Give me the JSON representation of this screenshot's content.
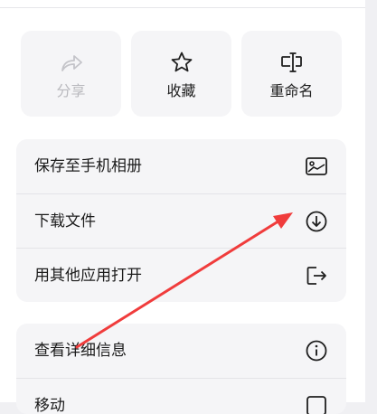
{
  "quick_actions": {
    "share_label": "分享",
    "favorite_label": "收藏",
    "rename_label": "重命名"
  },
  "menu_group_1": {
    "items": [
      {
        "label": "保存至手机相册",
        "icon": "image-icon"
      },
      {
        "label": "下载文件",
        "icon": "download-icon"
      },
      {
        "label": "用其他应用打开",
        "icon": "open-external-icon"
      }
    ]
  },
  "menu_group_2": {
    "items": [
      {
        "label": "查看详细信息",
        "icon": "info-icon"
      },
      {
        "label": "移动",
        "icon": "folder-icon"
      }
    ]
  },
  "colors": {
    "background": "#ffffff",
    "tile": "#f5f5f7",
    "text": "#1c1c1c",
    "disabled_text": "#b9b9be",
    "annotation_arrow": "#f03c3c"
  }
}
